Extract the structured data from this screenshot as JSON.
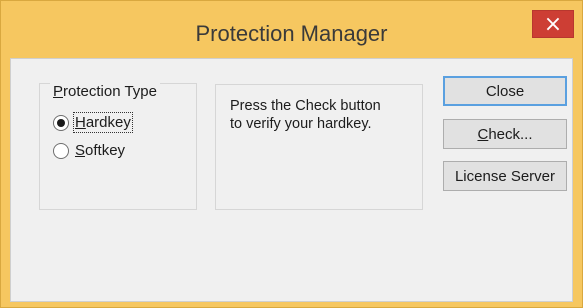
{
  "window": {
    "title": "Protection Manager",
    "close_glyph": "×"
  },
  "protection_type": {
    "label_first": "P",
    "label_rest": "rotection Type",
    "options": [
      {
        "label_first": "H",
        "label_rest": "ardkey",
        "selected": true
      },
      {
        "label_first": "S",
        "label_rest": "oftkey",
        "selected": false
      }
    ]
  },
  "info": {
    "line1": "Press the Check button",
    "line2": "to verify your hardkey."
  },
  "buttons": {
    "close": "Close",
    "check_first": "C",
    "check_rest": "heck...",
    "license_server": "License Server"
  },
  "colors": {
    "titlebar": "#f6c760",
    "close_button": "#cd3e34",
    "default_button_border": "#5aa0e0"
  }
}
